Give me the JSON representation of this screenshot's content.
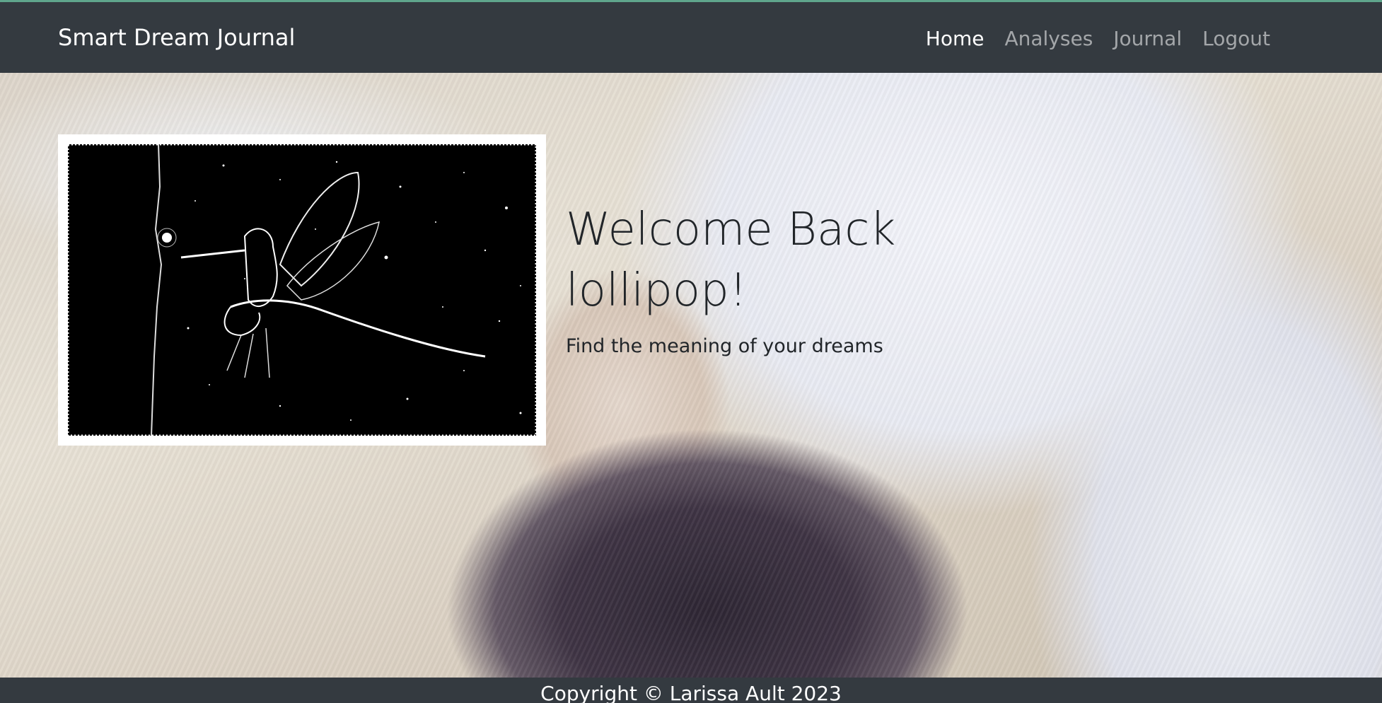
{
  "navbar": {
    "brand": "Smart Dream Journal",
    "links": [
      {
        "label": "Home",
        "active": true
      },
      {
        "label": "Analyses",
        "active": false
      },
      {
        "label": "Journal",
        "active": false
      },
      {
        "label": "Logout",
        "active": false
      }
    ]
  },
  "hero": {
    "welcome_line1": "Welcome Back",
    "welcome_line2": "lollipop!",
    "tagline": "Find the meaning of your dreams"
  },
  "footer": {
    "copyright": "Copyright © Larissa Ault 2023"
  },
  "colors": {
    "navbar_bg": "#343a40",
    "accent_line": "#5fa58c",
    "active_link": "#ffffff",
    "inactive_link": "rgba(255,255,255,0.55)",
    "text_dark": "#212529"
  }
}
